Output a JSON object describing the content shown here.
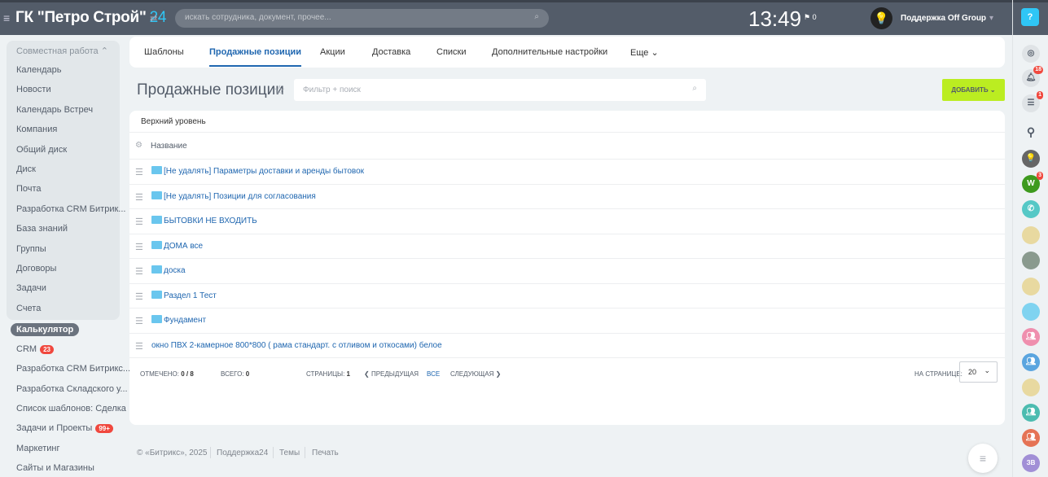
{
  "header": {
    "company": "ГК \"Петро Строй\"",
    "company_suffix": "24",
    "search_placeholder": "искать сотрудника, документ, прочее...",
    "time": "13:49",
    "flag_count": "0",
    "user": "Поддержка Off Group"
  },
  "sidebar": {
    "group_title": "Совместная работа",
    "items": [
      "Календарь",
      "Новости",
      "Календарь Встреч",
      "Компания",
      "Общий диск",
      "Диск",
      "Почта",
      "Разработка CRM Битрик...",
      "База знаний",
      "Группы",
      "Договоры",
      "Задачи",
      "Счета"
    ],
    "active": "Калькулятор",
    "items2": [
      {
        "label": "CRM",
        "count": "23"
      },
      {
        "label": "Разработка CRM Битрикс..."
      },
      {
        "label": "Разработка Складского у..."
      },
      {
        "label": "Список шаблонов: Сделка"
      },
      {
        "label": "Задачи и Проекты",
        "count": "99+"
      },
      {
        "label": "Маркетинг"
      },
      {
        "label": "Сайты и Магазины"
      }
    ]
  },
  "tabs": [
    "Шаблоны",
    "Продажные позиции",
    "Акции",
    "Доставка",
    "Списки",
    "Дополнительные настройки",
    "Еще"
  ],
  "page": {
    "title": "Продажные позиции",
    "filter_placeholder": "Фильтр + поиск",
    "add_label": "ДОБАВИТЬ"
  },
  "table": {
    "level": "Верхний уровень",
    "column": "Название",
    "rows": [
      {
        "name": "[Не удалять] Параметры доставки и аренды бытовок",
        "folder": true
      },
      {
        "name": "[Не удалять] Позиции для согласования",
        "folder": true
      },
      {
        "name": "БЫТОВКИ НЕ ВХОДИТЬ",
        "folder": true
      },
      {
        "name": "ДОМА все",
        "folder": true
      },
      {
        "name": "доска",
        "folder": true
      },
      {
        "name": "Раздел 1 Тест",
        "folder": true
      },
      {
        "name": "Фундамент",
        "folder": true
      },
      {
        "name": "окно ПВХ 2-камерное 800*800 ( рама стандарт. с отливом и откосами) белое",
        "folder": false
      }
    ]
  },
  "pagination": {
    "selected_label": "ОТМЕЧЕНО:",
    "selected": "0 / 8",
    "total_label": "ВСЕГО:",
    "total": "0",
    "pages_label": "СТРАНИЦЫ:",
    "pages": "1",
    "prev": "ПРЕДЫДУЩАЯ",
    "all": "ВСЕ",
    "next": "СЛЕДУЮЩАЯ",
    "per_page_label": "НА СТРАНИЦЕ:",
    "per_page": "20"
  },
  "footer": [
    "© «Битрикс», 2025",
    "Поддержка24",
    "Темы",
    "Печать"
  ],
  "right_panel": {
    "notifications": "18",
    "messages": "1",
    "w_badge": "3",
    "w_label": "W",
    "last_avatar": "ЗВ"
  }
}
